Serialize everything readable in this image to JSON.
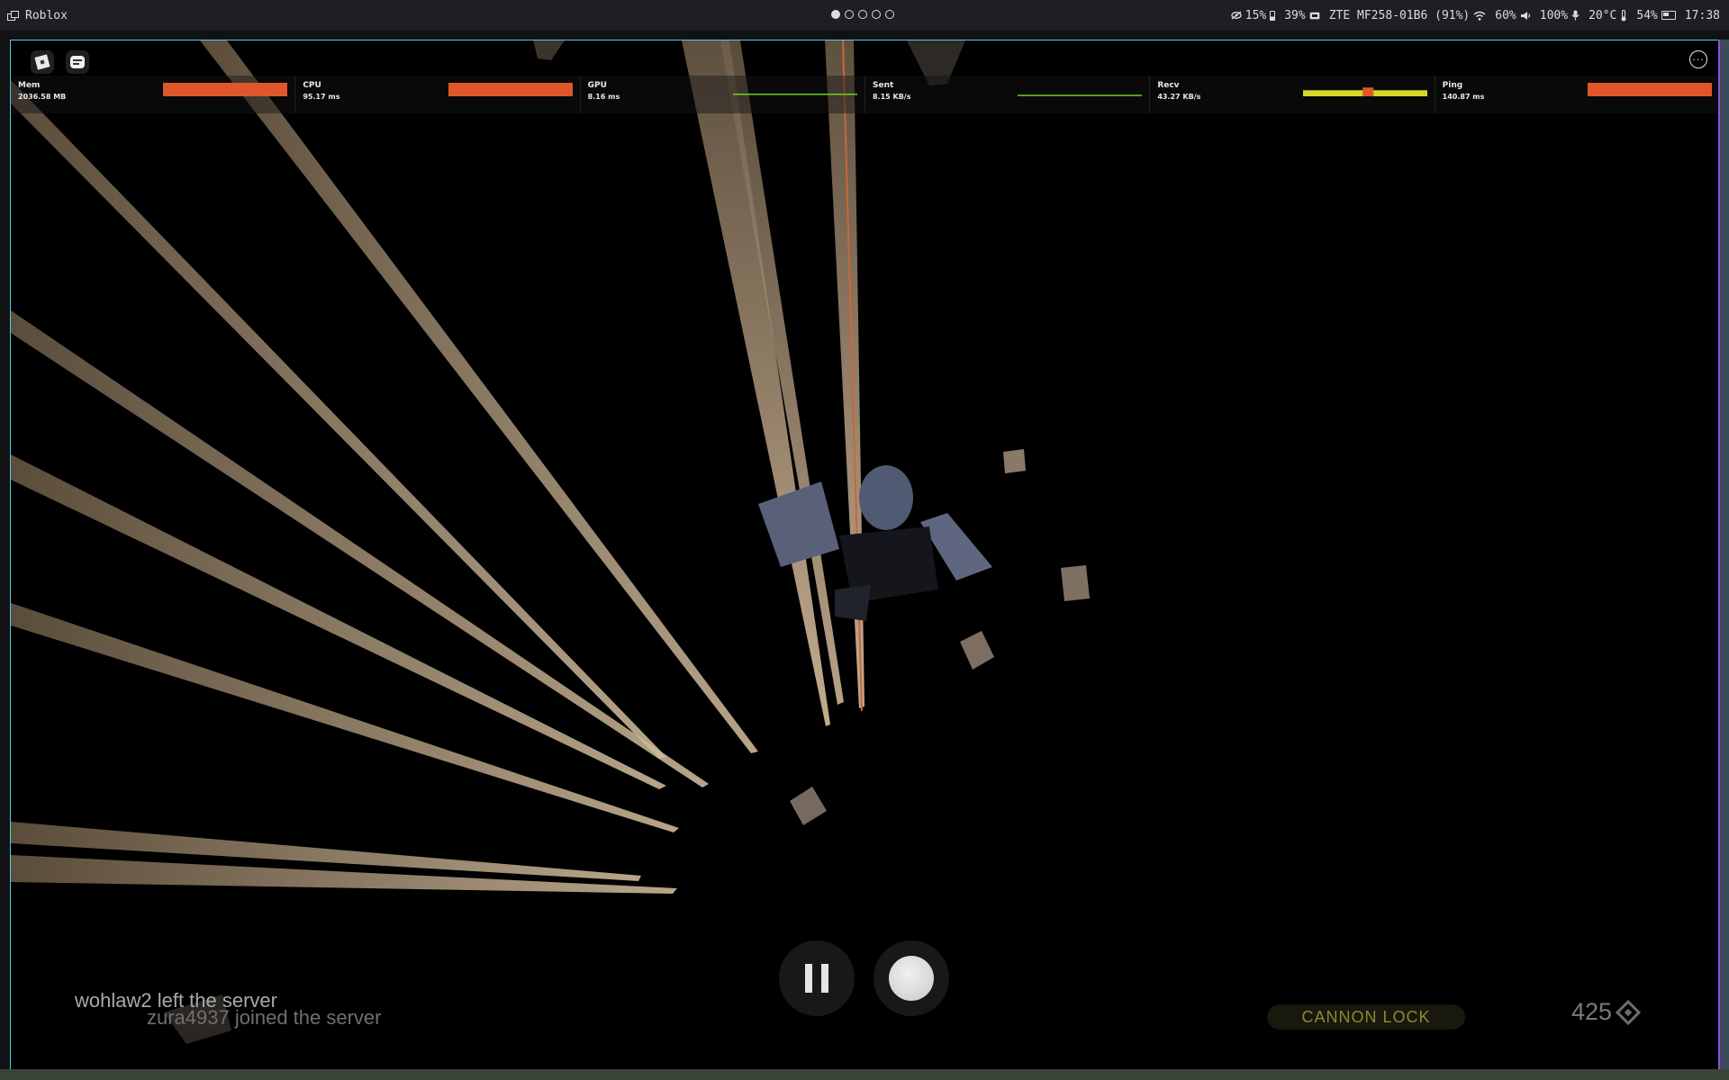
{
  "topbar": {
    "app_title": "Roblox",
    "workspaces": [
      {
        "active": true
      },
      {
        "active": false
      },
      {
        "active": false
      },
      {
        "active": false
      },
      {
        "active": false
      }
    ],
    "tray": {
      "cpu": "15%",
      "battery_device": "39%",
      "network": "ZTE MF258-01B6 (91%)",
      "brightness": "60%",
      "volume": "100%",
      "temperature": "20°C",
      "battery": "54%",
      "clock": "17:38"
    }
  },
  "game": {
    "stats": [
      {
        "name": "Mem",
        "value": "2036.58 MB",
        "graph": "bar",
        "color": "#e0562b",
        "level": 1.0
      },
      {
        "name": "CPU",
        "value": "95.17 ms",
        "graph": "bar",
        "color": "#e0562b",
        "level": 1.0
      },
      {
        "name": "GPU",
        "value": "8.16 ms",
        "graph": "line",
        "color": "#6bd02a",
        "level": 0.15
      },
      {
        "name": "Sent",
        "value": "8.15 KB/s",
        "graph": "line",
        "color": "#6bd02a",
        "level": 0.05
      },
      {
        "name": "Recv",
        "value": "43.27 KB/s",
        "graph": "bar",
        "color": "#d6d62a",
        "accent": "#e0562b",
        "level": 0.45
      },
      {
        "name": "Ping",
        "value": "140.87 ms",
        "graph": "bar",
        "color": "#e0562b",
        "level": 1.0
      }
    ],
    "chat_feed": [
      "wohlaw2 left the server",
      "zura4937 joined the server"
    ],
    "cannon_lock_label": "CANNON LOCK",
    "currency_amount": "425",
    "colors": {
      "accent_border": "#57c7e6",
      "orange": "#e0562b",
      "green": "#6bd02a",
      "yellow": "#d6d62a"
    }
  }
}
